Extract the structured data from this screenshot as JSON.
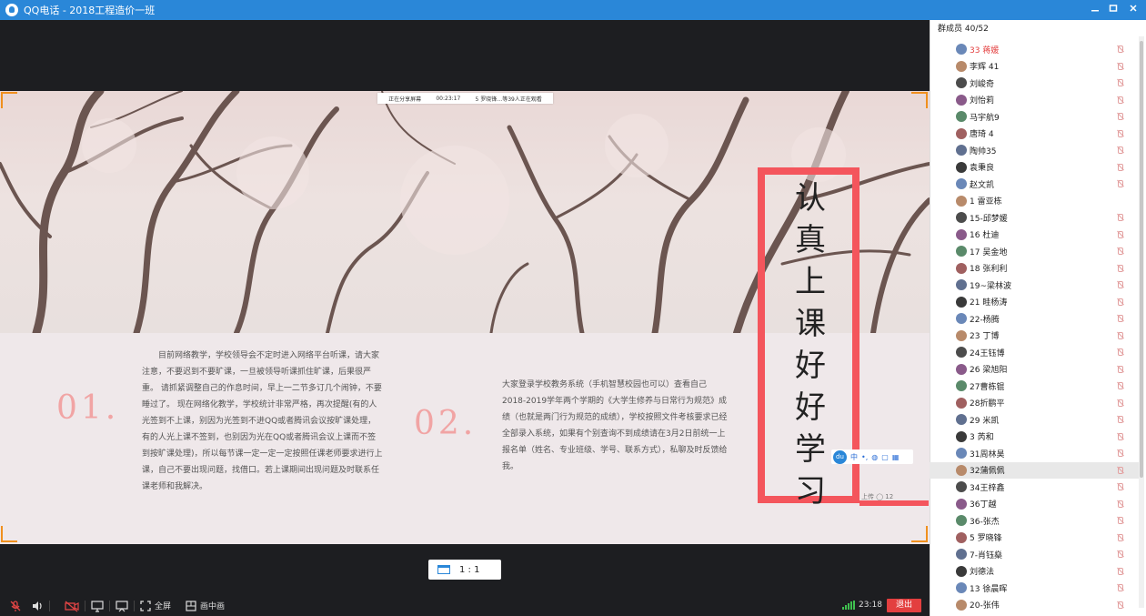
{
  "titlebar": {
    "title": "QQ电话 - 2018工程造价一班"
  },
  "share_banner": {
    "status": "正在分享屏幕",
    "duration": "00:23:17",
    "viewers": "5 罗晓锋…等39人正在观看"
  },
  "slide": {
    "num1": "01.",
    "num2": "02.",
    "para1": "目前网络教学，学校领导会不定时进入网络平台听课，请大家注意，不要迟到不要旷课，一旦被领导听课抓住旷课，后果很严重。 请抓紧调整自己的作息时间，早上一二节多订几个闹钟，不要睡过了。 现在网络化教学，学校统计非常严格，再次提醒(有的人光签到不上课，别因为光签到不进QQ或者腾讯会议按旷课处理，有的人光上课不签到，也别因为光在QQ或者腾讯会议上课而不签到按旷课处理)，所以每节课一定一定一定按照任课老师要求进行上课，自己不要出现问题，找借口。若上课期间出现问题及时联系任课老师和我解决。",
    "para2": "大家登录学校教务系统（手机智慧校园也可以）查看自己2018-2019学年两个学期的《大学生修养与日常行为规范》成绩（也就是两门行为规范的成绩），学校按照文件考核要求已经全部录入系统，如果有个别查询不到成绩请在3月2日前统一上报名单（姓名、专业班级、学号、联系方式），私聊及时反馈给我。",
    "slogan": [
      "认",
      "真",
      "上",
      "课",
      "好",
      "好",
      "学",
      "习"
    ],
    "meta": "上传 ◯ 12"
  },
  "ime": {
    "logo": "du",
    "mode": "中"
  },
  "ratio": {
    "label": "1 : 1"
  },
  "toolbar": {
    "fullscreen": "全屏",
    "pip": "画中画",
    "time": "23:18",
    "exit": "退出"
  },
  "members_panel": {
    "header": "群成员 40/52",
    "items": [
      {
        "name": "33 蒋媛",
        "highlight": true,
        "muted": true
      },
      {
        "name": "李辉 41",
        "muted": true
      },
      {
        "name": "刘峻奇",
        "muted": true
      },
      {
        "name": "刘怡莉",
        "muted": true
      },
      {
        "name": "马宇航9",
        "muted": true
      },
      {
        "name": "唐琦 4",
        "muted": true
      },
      {
        "name": "陶帅35",
        "muted": true
      },
      {
        "name": "袁秉良",
        "muted": true
      },
      {
        "name": "赵文凯",
        "muted": true
      },
      {
        "name": "1 雷亚栋",
        "muted": false
      },
      {
        "name": "15-邱梦媛",
        "muted": true
      },
      {
        "name": "16 杜迪",
        "muted": true
      },
      {
        "name": "17 吴金地",
        "muted": true
      },
      {
        "name": "18 张利利",
        "muted": true
      },
      {
        "name": "19~梁林波",
        "muted": true
      },
      {
        "name": "21 眭杨涛",
        "muted": true
      },
      {
        "name": "22-杨腾",
        "muted": true
      },
      {
        "name": "23 丁博",
        "muted": true
      },
      {
        "name": "24王钰博",
        "muted": true
      },
      {
        "name": "26 梁旭阳",
        "muted": true
      },
      {
        "name": "27曹栋锟",
        "muted": true
      },
      {
        "name": "28折鹏平",
        "muted": true
      },
      {
        "name": "29 米凯",
        "muted": true
      },
      {
        "name": "3 芮和",
        "muted": true
      },
      {
        "name": "31周林昊",
        "muted": true
      },
      {
        "name": "32蒲佩佩",
        "muted": true,
        "selected": true
      },
      {
        "name": "34王梓鑫",
        "muted": true
      },
      {
        "name": "36丁越",
        "muted": true
      },
      {
        "name": "36-张杰",
        "muted": true
      },
      {
        "name": "5 罗晓锋",
        "muted": true
      },
      {
        "name": "7-肖钰燊",
        "muted": true
      },
      {
        "name": "刘德法",
        "muted": true
      },
      {
        "name": "13 徐晨晖",
        "muted": true
      },
      {
        "name": "20-张伟",
        "muted": true
      }
    ]
  },
  "colors": {
    "titlebar": "#2a87d8",
    "accent_red": "#f4555c",
    "exit_red": "#e33f3f",
    "corner_orange": "#f0901e",
    "highlight_name": "#e33f3f"
  }
}
